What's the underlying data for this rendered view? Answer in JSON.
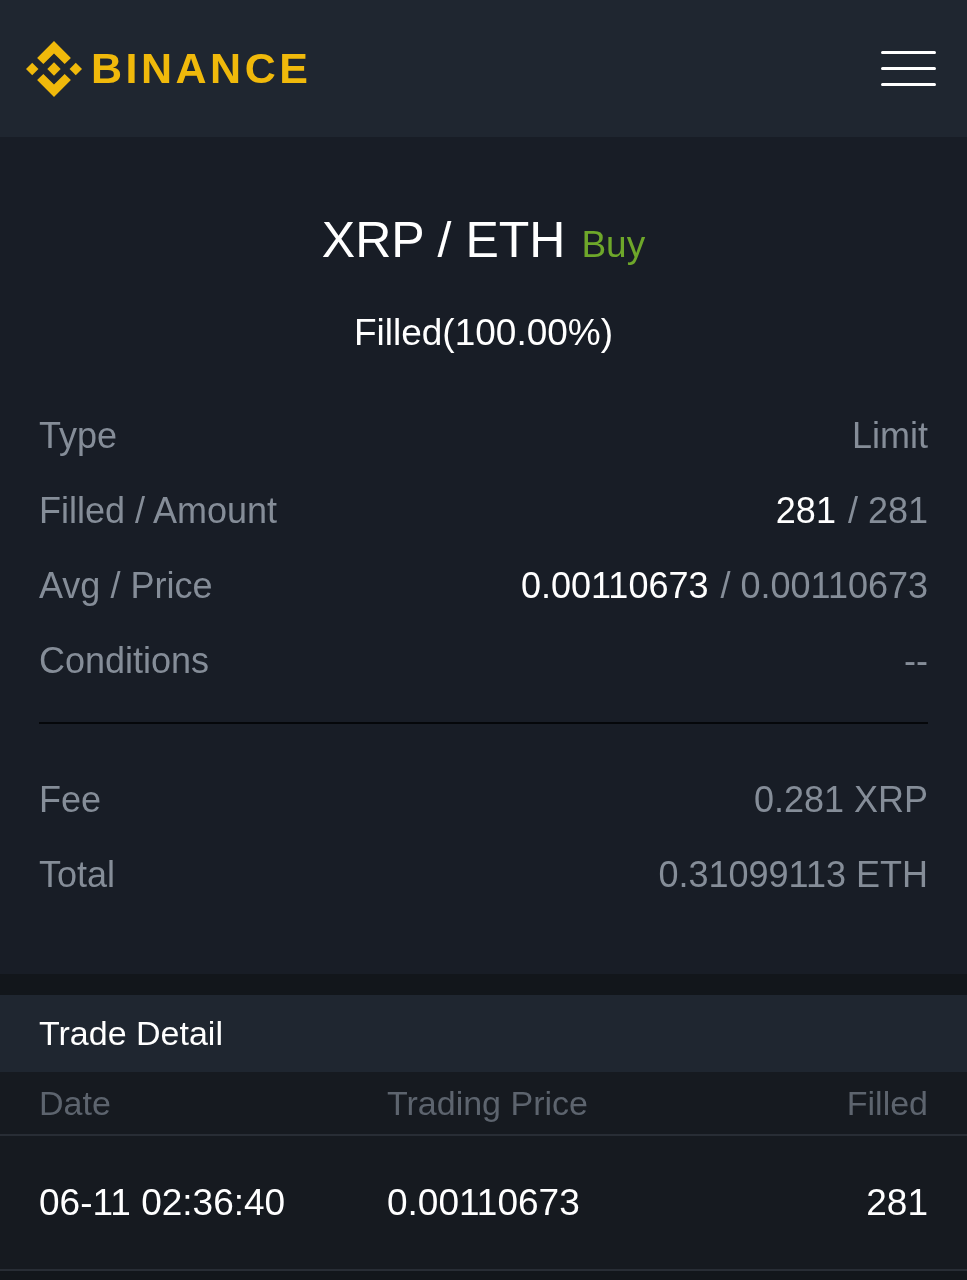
{
  "header": {
    "brand": "BINANCE"
  },
  "order": {
    "pair": "XRP / ETH",
    "side": {
      "label": "Buy",
      "kind": "buy"
    },
    "status": "Filled(100.00%)",
    "details": [
      {
        "label": "Type",
        "value": "Limit"
      },
      {
        "label": "Filled / Amount",
        "emphasis": "281",
        "value": "/ 281"
      },
      {
        "label": "Avg / Price",
        "emphasis": "0.00110673",
        "value": "/ 0.00110673"
      },
      {
        "label": "Conditions",
        "value": "--"
      }
    ],
    "costs": [
      {
        "label": "Fee",
        "value": "0.281 XRP"
      },
      {
        "label": "Total",
        "value": "0.31099113 ETH"
      }
    ]
  },
  "trade_detail": {
    "title": "Trade Detail",
    "columns": [
      "Date",
      "Trading Price",
      "Filled"
    ],
    "rows": [
      [
        "06-11 02:36:40",
        "0.00110673",
        "281"
      ]
    ]
  }
}
